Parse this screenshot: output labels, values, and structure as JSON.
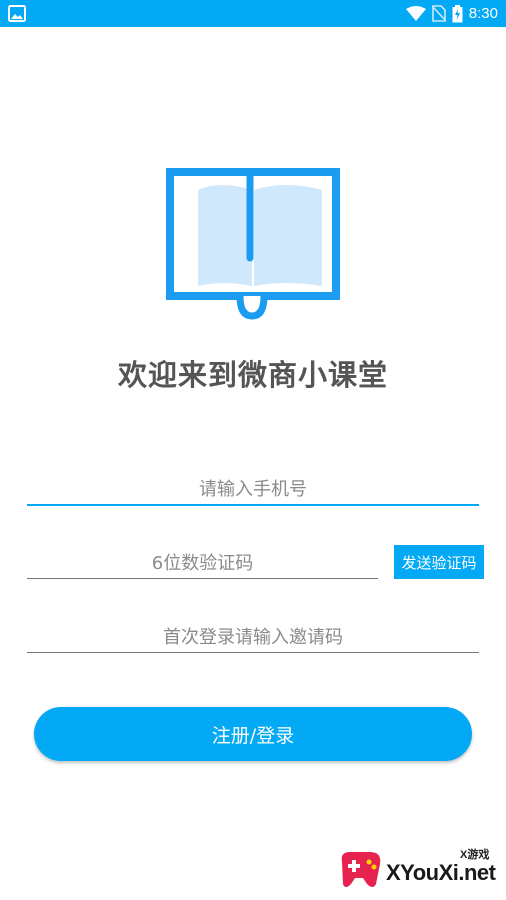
{
  "status_bar": {
    "time": "8:30",
    "left_icon": "image-icon",
    "right_icons": [
      "wifi-icon",
      "no-sim-icon",
      "battery-charging-icon"
    ]
  },
  "app": {
    "logo_icon": "open-book-icon",
    "title": "欢迎来到微商小课堂"
  },
  "form": {
    "phone_placeholder": "请输入手机号",
    "code_placeholder": "6位数验证码",
    "send_code_label": "发送验证码",
    "invite_placeholder": "首次登录请输入邀请码",
    "submit_label": "注册/登录"
  },
  "watermark": {
    "small_text": "X游戏",
    "text": "XYouXi.net"
  },
  "colors": {
    "accent": "#03a9f4",
    "title": "#555555",
    "placeholder": "#8a8a8a"
  }
}
